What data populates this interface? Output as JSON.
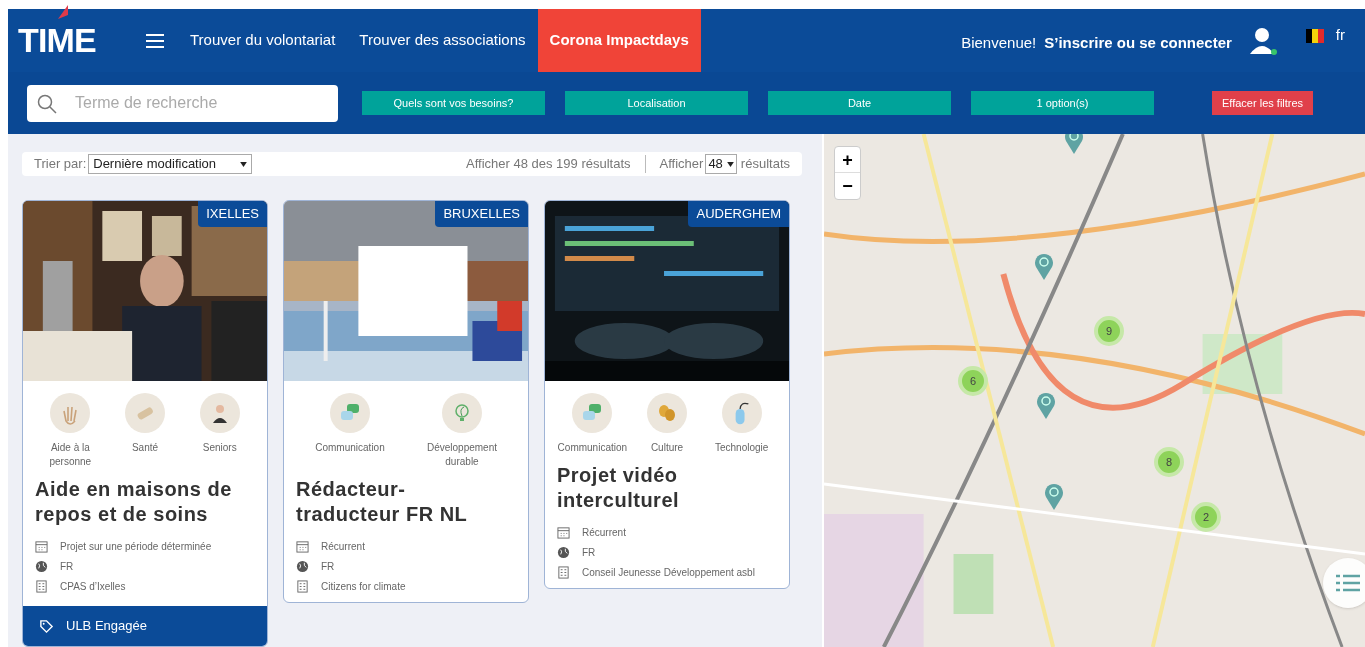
{
  "header": {
    "logo": "TIME",
    "nav": [
      {
        "label": "Trouver du volontariat",
        "selected": false
      },
      {
        "label": "Trouver des associations",
        "selected": false
      },
      {
        "label": "Corona Impactdays",
        "selected": true
      }
    ],
    "welcome": "Bienvenue!",
    "login": "S’inscrire ou se connecter",
    "language": "fr"
  },
  "filters": {
    "search": {
      "placeholder": "Terme de recherche"
    },
    "buttons": [
      {
        "label": "Quels sont vos besoins?",
        "kind": "filter"
      },
      {
        "label": "Localisation",
        "kind": "filter"
      },
      {
        "label": "Date",
        "kind": "filter"
      },
      {
        "label": "1 option(s)",
        "kind": "filter"
      },
      {
        "label": "Effacer les filtres",
        "kind": "clear"
      }
    ]
  },
  "toolbar": {
    "sort_label": "Trier par:",
    "sort_value": "Dernière modification",
    "count": "Afficher 48 des 199 résultats",
    "show_label": "Afficher",
    "show_value": "48",
    "show_suffix": "résultats"
  },
  "cards": [
    {
      "location": "IXELLES",
      "categories": [
        {
          "label": "Aide à la personne"
        },
        {
          "label": "Santé"
        },
        {
          "label": "Seniors"
        }
      ],
      "title": "Aide en maisons de repos et de soins",
      "details": [
        {
          "kind": "calendar",
          "text": "Projet sur une période déterminée"
        },
        {
          "kind": "language",
          "text": "FR"
        },
        {
          "kind": "organization",
          "text": "CPAS d’Ixelles"
        }
      ],
      "footer": "ULB Engagée"
    },
    {
      "location": "BRUXELLES",
      "categories": [
        {
          "label": "Communication"
        },
        {
          "label": "Développement durable"
        }
      ],
      "title": "Rédacteur-traducteur FR NL",
      "details": [
        {
          "kind": "calendar",
          "text": "Récurrent"
        },
        {
          "kind": "language",
          "text": "FR"
        },
        {
          "kind": "organization",
          "text": "Citizens for climate"
        }
      ]
    },
    {
      "location": "AUDERGHEM",
      "categories": [
        {
          "label": "Communication"
        },
        {
          "label": "Culture"
        },
        {
          "label": "Technologie"
        }
      ],
      "title": "Projet vidéo interculturel",
      "details": [
        {
          "kind": "calendar",
          "text": "Récurrent"
        },
        {
          "kind": "language",
          "text": "FR"
        },
        {
          "kind": "organization",
          "text": "Conseil Jeunesse Développement asbl"
        }
      ]
    }
  ],
  "map": {
    "zoom_in": "+",
    "zoom_out": "−",
    "clusters": [
      {
        "count": "9"
      },
      {
        "count": "6"
      },
      {
        "count": "8"
      },
      {
        "count": "2"
      }
    ]
  }
}
